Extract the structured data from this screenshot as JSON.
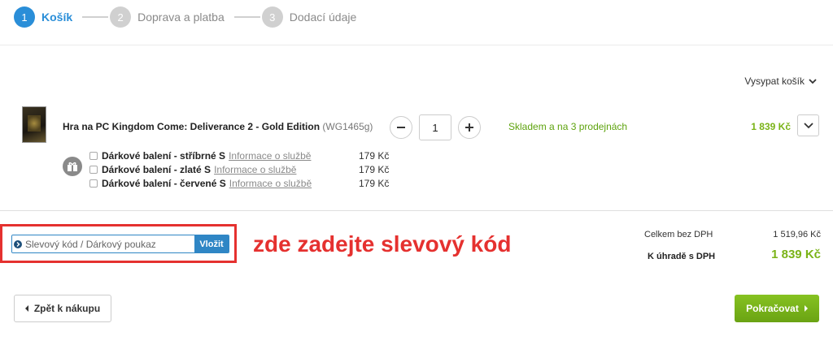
{
  "steps": [
    {
      "number": "1",
      "label": "Košík",
      "active": true
    },
    {
      "number": "2",
      "label": "Doprava a platba",
      "active": false
    },
    {
      "number": "3",
      "label": "Dodací údaje",
      "active": false
    }
  ],
  "cart": {
    "empty_label": "Vysypat košík",
    "product": {
      "name": "Hra na PC Kingdom Come: Deliverance 2 - Gold Edition",
      "code": "(WG1465g)",
      "quantity": "1",
      "stock": "Skladem a na 3 prodejnách",
      "price": "1 839 Kč"
    },
    "services": [
      {
        "name": "Dárkové balení - stříbrné S",
        "link": "Informace o službě",
        "price": "179 Kč"
      },
      {
        "name": "Dárkové balení - zlaté S",
        "link": "Informace o službě",
        "price": "179 Kč"
      },
      {
        "name": "Dárkové balení - červené S",
        "link": "Informace o službě",
        "price": "179 Kč"
      }
    ]
  },
  "discount": {
    "placeholder": "Slevový kód / Dárkový poukaz",
    "button": "Vložit",
    "annotation": "zde zadejte slevový kód"
  },
  "totals": {
    "without_vat_label": "Celkem bez DPH",
    "without_vat_value": "1 519,96 Kč",
    "to_pay_label": "K úhradě s DPH",
    "to_pay_value": "1 839 Kč"
  },
  "nav": {
    "back": "Zpět k nákupu",
    "next": "Pokračovat"
  },
  "colors": {
    "accent": "#2a8ed8",
    "price_green": "#7ab317",
    "annotation_red": "#e5312f"
  }
}
